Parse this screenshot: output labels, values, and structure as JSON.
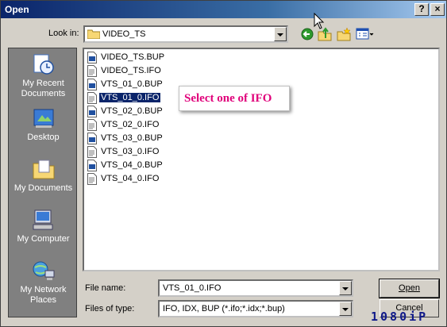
{
  "window": {
    "title": "Open",
    "help_label": "?",
    "close_label": "×"
  },
  "lookin": {
    "label": "Look in:",
    "value": "VIDEO_TS"
  },
  "places": [
    {
      "label": "My Recent Documents"
    },
    {
      "label": "Desktop"
    },
    {
      "label": "My Documents"
    },
    {
      "label": "My Computer"
    },
    {
      "label": "My Network Places"
    }
  ],
  "files": [
    {
      "name": "VIDEO_TS.BUP",
      "type": "bup",
      "selected": false
    },
    {
      "name": "VIDEO_TS.IFO",
      "type": "ifo",
      "selected": false
    },
    {
      "name": "VTS_01_0.BUP",
      "type": "bup",
      "selected": false
    },
    {
      "name": "VTS_01_0.IFO",
      "type": "ifo",
      "selected": true
    },
    {
      "name": "VTS_02_0.BUP",
      "type": "bup",
      "selected": false
    },
    {
      "name": "VTS_02_0.IFO",
      "type": "ifo",
      "selected": false
    },
    {
      "name": "VTS_03_0.BUP",
      "type": "bup",
      "selected": false
    },
    {
      "name": "VTS_03_0.IFO",
      "type": "ifo",
      "selected": false
    },
    {
      "name": "VTS_04_0.BUP",
      "type": "bup",
      "selected": false
    },
    {
      "name": "VTS_04_0.IFO",
      "type": "ifo",
      "selected": false
    }
  ],
  "annotation": "Select one of IFO",
  "filename": {
    "label": "File name:",
    "value": "VTS_01_0.IFO"
  },
  "filetype": {
    "label": "Files of type:",
    "value": "IFO, IDX, BUP (*.ifo;*.idx;*.bup)"
  },
  "buttons": {
    "open": "Open",
    "cancel": "Cancel"
  },
  "watermark": "1080iP",
  "colors": {
    "titlebar": "#0a246a",
    "selection": "#0a246a",
    "annotation": "#e0007a",
    "places_bg": "#808080"
  }
}
